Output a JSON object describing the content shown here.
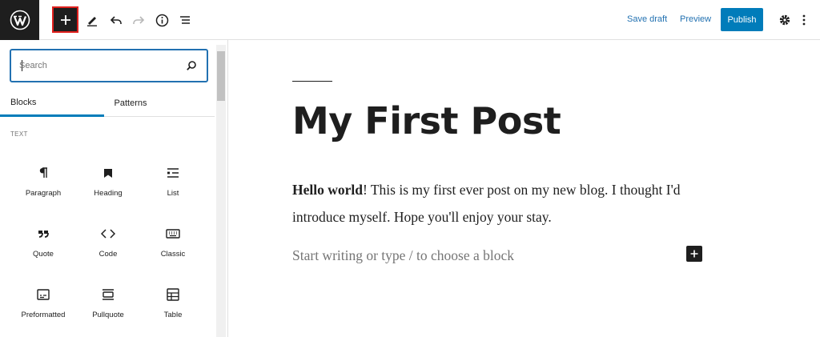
{
  "header": {
    "save_draft": "Save draft",
    "preview": "Preview",
    "publish": "Publish",
    "icons": [
      "wordpress-logo",
      "plus-icon",
      "pencil-icon",
      "undo-icon",
      "redo-icon",
      "info-icon",
      "list-view-icon",
      "gear-icon",
      "more-vertical-icon"
    ]
  },
  "inserter": {
    "search_placeholder": "Search",
    "tabs": [
      {
        "label": "Blocks",
        "active": true
      },
      {
        "label": "Patterns",
        "active": false
      }
    ],
    "category": "TEXT",
    "blocks": [
      {
        "label": "Paragraph",
        "icon": "paragraph-icon"
      },
      {
        "label": "Heading",
        "icon": "bookmark-icon"
      },
      {
        "label": "List",
        "icon": "list-icon"
      },
      {
        "label": "Quote",
        "icon": "quote-icon"
      },
      {
        "label": "Code",
        "icon": "code-icon"
      },
      {
        "label": "Classic",
        "icon": "keyboard-icon"
      },
      {
        "label": "Preformatted",
        "icon": "preformatted-icon"
      },
      {
        "label": "Pullquote",
        "icon": "pullquote-icon"
      },
      {
        "label": "Table",
        "icon": "table-icon"
      }
    ]
  },
  "editor": {
    "title": "My First Post",
    "paragraph_bold": "Hello world",
    "paragraph_rest": "! This is my first ever post on my new blog. I thought I'd introduce myself. Hope you'll enjoy your stay.",
    "placeholder": "Start writing or type / to choose a block"
  },
  "colors": {
    "accent": "#007cba",
    "link": "#2271b1",
    "highlight_outline": "#e0201d",
    "dark": "#1e1e1e"
  }
}
